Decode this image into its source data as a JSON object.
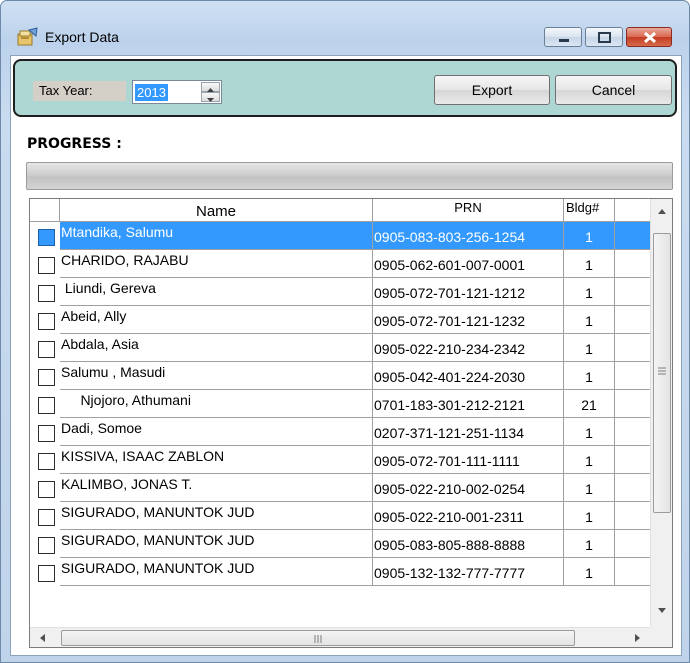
{
  "window": {
    "title": "Export Data",
    "icon": "export-data-app-icon"
  },
  "toolbar": {
    "tax_year_label": "Tax Year:",
    "tax_year_value": "2013",
    "export_label": "Export",
    "cancel_label": "Cancel"
  },
  "progress": {
    "label": "PROGRESS :",
    "value": 0
  },
  "grid": {
    "columns": [
      "",
      "Name",
      "PRN",
      "Bldg#"
    ],
    "rows": [
      {
        "name": "Mtandika, Salumu",
        "prn": "0905-083-803-256-1254",
        "bldg": "1",
        "selected": true
      },
      {
        "name": "CHARIDO, RAJABU",
        "prn": "0905-062-601-007-0001",
        "bldg": "1"
      },
      {
        "name": " Liundi, Gereva",
        "prn": "0905-072-701-121-1212",
        "bldg": "1"
      },
      {
        "name": "Abeid, Ally",
        "prn": "0905-072-701-121-1232",
        "bldg": "1"
      },
      {
        "name": "Abdala, Asia",
        "prn": "0905-022-210-234-2342",
        "bldg": "1"
      },
      {
        "name": "Salumu , Masudi",
        "prn": "0905-042-401-224-2030",
        "bldg": "1"
      },
      {
        "name": "     Njojoro, Athumani",
        "prn": "0701-183-301-212-2121",
        "bldg": "21"
      },
      {
        "name": "Dadi, Somoe",
        "prn": "0207-371-121-251-1134",
        "bldg": "1"
      },
      {
        "name": "KISSIVA, ISAAC ZABLON",
        "prn": "0905-072-701-111-1111",
        "bldg": "1"
      },
      {
        "name": "KALIMBO, JONAS T.",
        "prn": "0905-022-210-002-0254",
        "bldg": "1"
      },
      {
        "name": "SIGURADO, MANUNTOK JUD",
        "prn": "0905-022-210-001-2311",
        "bldg": "1"
      },
      {
        "name": "SIGURADO, MANUNTOK JUD",
        "prn": "0905-083-805-888-8888",
        "bldg": "1"
      },
      {
        "name": "SIGURADO, MANUNTOK JUD",
        "prn": "0905-132-132-777-7777",
        "bldg": "1"
      }
    ]
  },
  "colors": {
    "selection": "#3399ff",
    "toolbar_panel": "#aed7d3",
    "close_button": "#c43c22"
  }
}
